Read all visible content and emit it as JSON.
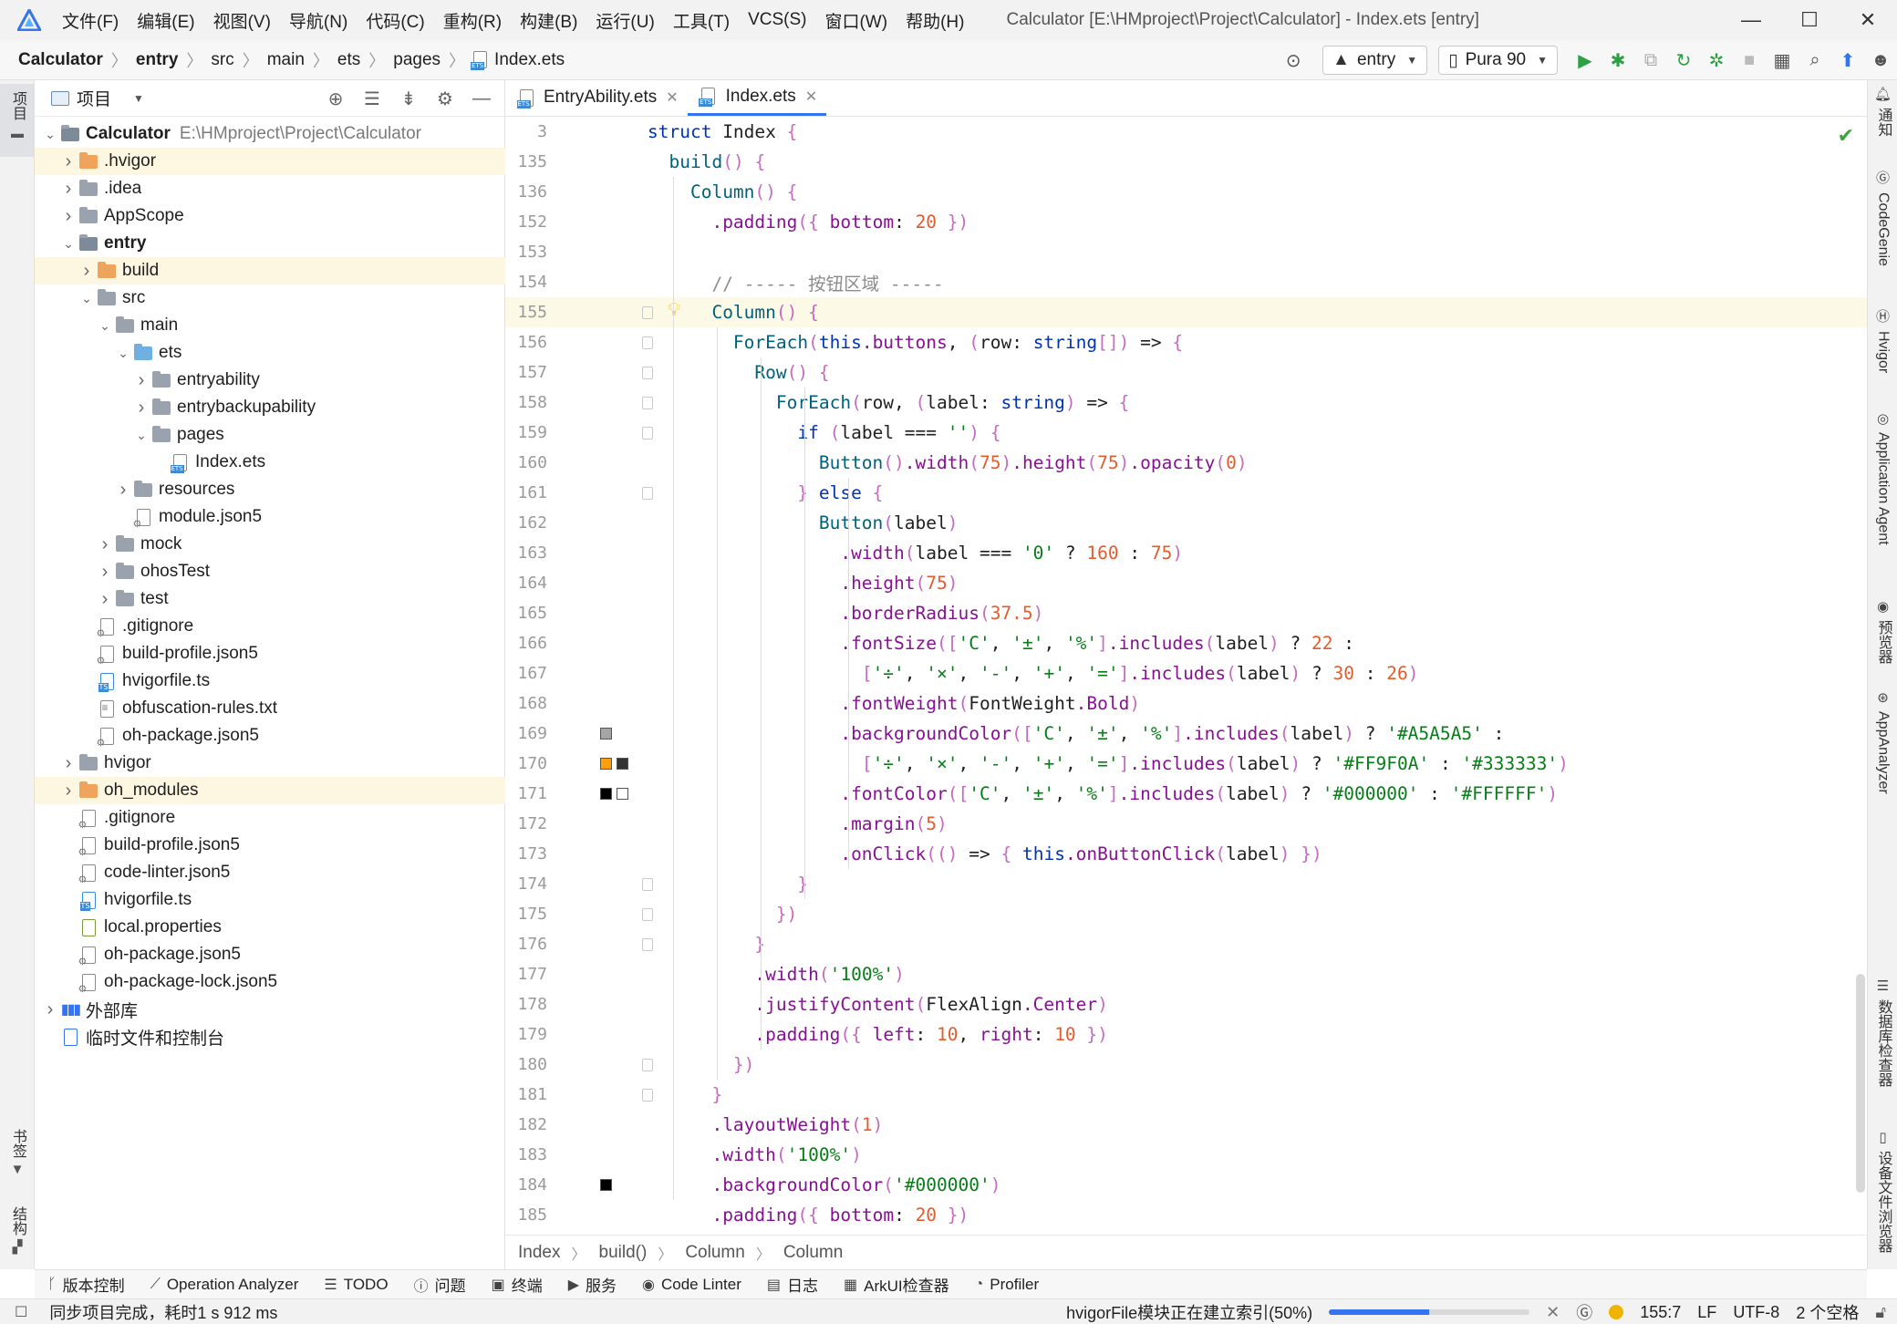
{
  "menubar": {
    "items": [
      "文件(F)",
      "编辑(E)",
      "视图(V)",
      "导航(N)",
      "代码(C)",
      "重构(R)",
      "构建(B)",
      "运行(U)",
      "工具(T)",
      "VCS(S)",
      "窗口(W)",
      "帮助(H)"
    ],
    "window_title": "Calculator [E:\\HMproject\\Project\\Calculator] - Index.ets [entry]",
    "minimize": "—",
    "maximize": "☐",
    "close": "✕"
  },
  "navbar": {
    "crumbs": [
      "Calculator",
      "entry",
      "src",
      "main",
      "ets",
      "pages",
      "Index.ets"
    ],
    "module_select": "entry",
    "device_select": "Pura 90"
  },
  "left_strip": {
    "top_label": "项目",
    "bookmarks_label": "书签",
    "structure_label": "结构"
  },
  "project_panel": {
    "title": "项目",
    "tree": [
      {
        "label": "Calculator",
        "path": "E:\\HMproject\\Project\\Calculator",
        "depth": 0,
        "chevron": "open",
        "icon": "folder-module",
        "bold": true
      },
      {
        "label": ".hvigor",
        "depth": 1,
        "chevron": "closed",
        "icon": "folder-orange",
        "highlight": true
      },
      {
        "label": ".idea",
        "depth": 1,
        "chevron": "closed",
        "icon": "folder"
      },
      {
        "label": "AppScope",
        "depth": 1,
        "chevron": "closed",
        "icon": "folder"
      },
      {
        "label": "entry",
        "depth": 1,
        "chevron": "open",
        "icon": "folder-module",
        "bold": true
      },
      {
        "label": "build",
        "depth": 2,
        "chevron": "closed",
        "icon": "folder-orange",
        "highlight": true
      },
      {
        "label": "src",
        "depth": 2,
        "chevron": "open",
        "icon": "folder"
      },
      {
        "label": "main",
        "depth": 3,
        "chevron": "open",
        "icon": "folder"
      },
      {
        "label": "ets",
        "depth": 4,
        "chevron": "open",
        "icon": "folder-blue"
      },
      {
        "label": "entryability",
        "depth": 5,
        "chevron": "closed",
        "icon": "folder"
      },
      {
        "label": "entrybackupability",
        "depth": 5,
        "chevron": "closed",
        "icon": "folder"
      },
      {
        "label": "pages",
        "depth": 5,
        "chevron": "open",
        "icon": "folder"
      },
      {
        "label": "Index.ets",
        "depth": 6,
        "chevron": "none",
        "icon": "file-ets"
      },
      {
        "label": "resources",
        "depth": 4,
        "chevron": "closed",
        "icon": "folder"
      },
      {
        "label": "module.json5",
        "depth": 4,
        "chevron": "none",
        "icon": "file-gear"
      },
      {
        "label": "mock",
        "depth": 3,
        "chevron": "closed",
        "icon": "folder"
      },
      {
        "label": "ohosTest",
        "depth": 3,
        "chevron": "closed",
        "icon": "folder"
      },
      {
        "label": "test",
        "depth": 3,
        "chevron": "closed",
        "icon": "folder"
      },
      {
        "label": ".gitignore",
        "depth": 2,
        "chevron": "none",
        "icon": "file-gear"
      },
      {
        "label": "build-profile.json5",
        "depth": 2,
        "chevron": "none",
        "icon": "file-gear"
      },
      {
        "label": "hvigorfile.ts",
        "depth": 2,
        "chevron": "none",
        "icon": "file-ts"
      },
      {
        "label": "obfuscation-rules.txt",
        "depth": 2,
        "chevron": "none",
        "icon": "file-txt"
      },
      {
        "label": "oh-package.json5",
        "depth": 2,
        "chevron": "none",
        "icon": "file-gear"
      },
      {
        "label": "hvigor",
        "depth": 1,
        "chevron": "closed",
        "icon": "folder"
      },
      {
        "label": "oh_modules",
        "depth": 1,
        "chevron": "closed",
        "icon": "folder-orange",
        "highlight": true
      },
      {
        "label": ".gitignore",
        "depth": 1,
        "chevron": "none",
        "icon": "file-gear"
      },
      {
        "label": "build-profile.json5",
        "depth": 1,
        "chevron": "none",
        "icon": "file-gear"
      },
      {
        "label": "code-linter.json5",
        "depth": 1,
        "chevron": "none",
        "icon": "file-gear"
      },
      {
        "label": "hvigorfile.ts",
        "depth": 1,
        "chevron": "none",
        "icon": "file-ts"
      },
      {
        "label": "local.properties",
        "depth": 1,
        "chevron": "none",
        "icon": "file-props"
      },
      {
        "label": "oh-package.json5",
        "depth": 1,
        "chevron": "none",
        "icon": "file-gear"
      },
      {
        "label": "oh-package-lock.json5",
        "depth": 1,
        "chevron": "none",
        "icon": "file-gear"
      },
      {
        "label": "外部库",
        "depth": 0,
        "chevron": "closed",
        "icon": "library"
      },
      {
        "label": "临时文件和控制台",
        "depth": 0,
        "chevron": "none",
        "icon": "scratch"
      }
    ]
  },
  "editor": {
    "tabs": [
      {
        "label": "EntryAbility.ets",
        "active": false
      },
      {
        "label": "Index.ets",
        "active": true
      }
    ],
    "lines": [
      {
        "n": "3",
        "code": "struct Index {"
      },
      {
        "n": "135",
        "code": "  build() {"
      },
      {
        "n": "136",
        "code": "    Column() {"
      },
      {
        "n": "152",
        "code": "      .padding({ bottom: 20 })"
      },
      {
        "n": "153",
        "code": ""
      },
      {
        "n": "154",
        "code": "      // ----- 按钮区域 -----"
      },
      {
        "n": "155",
        "code": "      Column() {"
      },
      {
        "n": "156",
        "code": "        ForEach(this.buttons, (row: string[]) => {"
      },
      {
        "n": "157",
        "code": "          Row() {"
      },
      {
        "n": "158",
        "code": "            ForEach(row, (label: string) => {"
      },
      {
        "n": "159",
        "code": "              if (label === '') {"
      },
      {
        "n": "160",
        "code": "                Button().width(75).height(75).opacity(0)"
      },
      {
        "n": "161",
        "code": "              } else {"
      },
      {
        "n": "162",
        "code": "                Button(label)"
      },
      {
        "n": "163",
        "code": "                  .width(label === '0' ? 160 : 75)"
      },
      {
        "n": "164",
        "code": "                  .height(75)"
      },
      {
        "n": "165",
        "code": "                  .borderRadius(37.5)"
      },
      {
        "n": "166",
        "code": "                  .fontSize(['C', '±', '%'].includes(label) ? 22 :"
      },
      {
        "n": "167",
        "code": "                    ['÷', '×', '-', '+', '='].includes(label) ? 30 : 26)"
      },
      {
        "n": "168",
        "code": "                  .fontWeight(FontWeight.Bold)"
      },
      {
        "n": "169",
        "code": "                  .backgroundColor(['C', '±', '%'].includes(label) ? '#A5A5A5' :"
      },
      {
        "n": "170",
        "code": "                    ['÷', '×', '-', '+', '='].includes(label) ? '#FF9F0A' : '#333333')"
      },
      {
        "n": "171",
        "code": "                  .fontColor(['C', '±', '%'].includes(label) ? '#000000' : '#FFFFFF')"
      },
      {
        "n": "172",
        "code": "                  .margin(5)"
      },
      {
        "n": "173",
        "code": "                  .onClick(() => { this.onButtonClick(label) })"
      },
      {
        "n": "174",
        "code": "              }"
      },
      {
        "n": "175",
        "code": "            })"
      },
      {
        "n": "176",
        "code": "          }"
      },
      {
        "n": "177",
        "code": "          .width('100%')"
      },
      {
        "n": "178",
        "code": "          .justifyContent(FlexAlign.Center)"
      },
      {
        "n": "179",
        "code": "          .padding({ left: 10, right: 10 })"
      },
      {
        "n": "180",
        "code": "        })"
      },
      {
        "n": "181",
        "code": "      }"
      },
      {
        "n": "182",
        "code": "      .layoutWeight(1)"
      },
      {
        "n": "183",
        "code": "      .width('100%')"
      },
      {
        "n": "184",
        "code": "      .backgroundColor('#000000')"
      },
      {
        "n": "185",
        "code": "      .padding({ bottom: 20 })"
      }
    ],
    "breadcrumb": [
      "Index",
      "build()",
      "Column",
      "Column"
    ],
    "swatch_colors": {
      "grey": "#A5A5A5",
      "orange": "#FF9F0A",
      "dark": "#333333",
      "black": "#000000",
      "white": "#FFFFFF"
    }
  },
  "right_strip": [
    "通知",
    "CodeGenie",
    "Hvigor",
    "Application Agent",
    "预览器",
    "AppAnalyzer",
    "数据库检查器",
    "设备文件浏览器"
  ],
  "tool_windows": [
    "版本控制",
    "Operation Analyzer",
    "TODO",
    "问题",
    "终端",
    "服务",
    "Code Linter",
    "日志",
    "ArkUI检查器",
    "Profiler"
  ],
  "statusbar": {
    "message": "同步项目完成，耗时1 s 912 ms",
    "indexing": "hvigorFile模块正在建立索引(50%)",
    "progress": 0.5,
    "position": "155:7",
    "line_ending": "LF",
    "encoding": "UTF-8",
    "indent": "2 个空格"
  }
}
